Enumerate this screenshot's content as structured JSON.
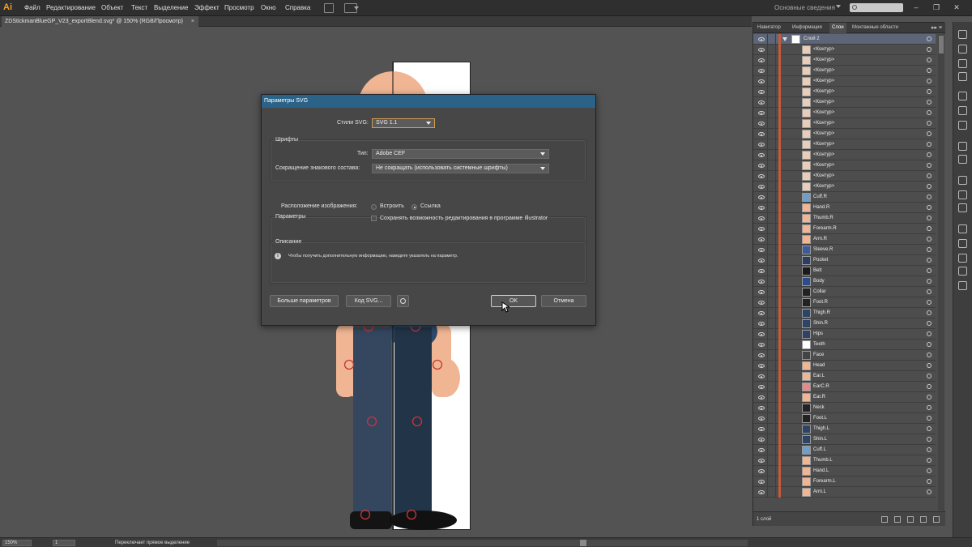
{
  "app": {
    "logo": "Ai",
    "menu": [
      "Файл",
      "Редактирование",
      "Объект",
      "Текст",
      "Выделение",
      "Эффект",
      "Просмотр",
      "Окно",
      "Справка"
    ],
    "workspace": "Основные сведения"
  },
  "document": {
    "tab_title": "ZDStickmanBlueGP_V23_exportBlend.svg* @ 150% (RGB/Просмотр)",
    "tab_close": "×"
  },
  "statusbar": {
    "zoom": "150%",
    "artboard": "1",
    "message": "Переключает прямое выделение"
  },
  "panel": {
    "tabs": [
      "Навигатор",
      "Информация",
      "Слои",
      "Монтажные области"
    ],
    "active_tab": "Слои",
    "layer_count": "1 слой",
    "layers": [
      {
        "name": "Слой 2",
        "thumb": "#ffffff",
        "sel": true,
        "top": true
      },
      {
        "name": "<Контур>",
        "thumb": "#e9cdb8"
      },
      {
        "name": "<Контур>",
        "thumb": "#e9cdb8"
      },
      {
        "name": "<Контур>",
        "thumb": "#e9cdb8"
      },
      {
        "name": "<Контур>",
        "thumb": "#e9cdb8"
      },
      {
        "name": "<Контур>",
        "thumb": "#e9cdb8"
      },
      {
        "name": "<Контур>",
        "thumb": "#e9cdb8"
      },
      {
        "name": "<Контур>",
        "thumb": "#e9cdb8"
      },
      {
        "name": "<Контур>",
        "thumb": "#e9cdb8"
      },
      {
        "name": "<Контур>",
        "thumb": "#e9cdb8"
      },
      {
        "name": "<Контур>",
        "thumb": "#e9cdb8"
      },
      {
        "name": "<Контур>",
        "thumb": "#e9cdb8"
      },
      {
        "name": "<Контур>",
        "thumb": "#e9cdb8"
      },
      {
        "name": "<Контур>",
        "thumb": "#e9cdb8"
      },
      {
        "name": "<Контур>",
        "thumb": "#e9cdb8"
      },
      {
        "name": "Cuff.R",
        "thumb": "#6f9ec9"
      },
      {
        "name": "Hand.R",
        "thumb": "#f0b694"
      },
      {
        "name": "Thumb.R",
        "thumb": "#f0b694"
      },
      {
        "name": "Forearm.R",
        "thumb": "#f0b694"
      },
      {
        "name": "Arm.R",
        "thumb": "#f0b694"
      },
      {
        "name": "Sleeve.R",
        "thumb": "#3a5b9c"
      },
      {
        "name": "Pocket",
        "thumb": "#2a3d64"
      },
      {
        "name": "Belt",
        "thumb": "#1a1a1a"
      },
      {
        "name": "Body",
        "thumb": "#2d4d8a"
      },
      {
        "name": "Collar",
        "thumb": "#222222"
      },
      {
        "name": "Foot.R",
        "thumb": "#222222"
      },
      {
        "name": "Thigh.R",
        "thumb": "#2e4466"
      },
      {
        "name": "Shin.R",
        "thumb": "#2e4466"
      },
      {
        "name": "Hips",
        "thumb": "#2e4466"
      },
      {
        "name": "Teeth",
        "thumb": "#ffffff"
      },
      {
        "name": "Face",
        "thumb": "#444444"
      },
      {
        "name": "Head",
        "thumb": "#f0b694"
      },
      {
        "name": "Ear.L",
        "thumb": "#f0b694"
      },
      {
        "name": "EarC.R",
        "thumb": "#e58a8a"
      },
      {
        "name": "Ear.R",
        "thumb": "#f0b694"
      },
      {
        "name": "Neck",
        "thumb": "#222222"
      },
      {
        "name": "Foot.L",
        "thumb": "#222222"
      },
      {
        "name": "Thigh.L",
        "thumb": "#2e4466"
      },
      {
        "name": "Shin.L",
        "thumb": "#2e4466"
      },
      {
        "name": "Cuff.L",
        "thumb": "#6f9ec9"
      },
      {
        "name": "Thumb.L",
        "thumb": "#f0b694"
      },
      {
        "name": "Hand.L",
        "thumb": "#f0b694"
      },
      {
        "name": "Forearm.L",
        "thumb": "#f0b694"
      },
      {
        "name": "Arm.L",
        "thumb": "#f0b694"
      }
    ]
  },
  "dialog": {
    "title": "Параметры SVG",
    "svg_profile_label": "Стили SVG:",
    "svg_profile_value": "SVG 1.1",
    "fonts_group": "Шрифты",
    "type_label": "Тип:",
    "type_value": "Adobe CEF",
    "subset_label": "Сокращение знакового состава:",
    "subset_value": "Не сокращать (использовать системные шрифты)",
    "options_group": "Параметры",
    "image_location_label": "Расположение изображения:",
    "embed_label": "Встроить",
    "link_label": "Ссылка",
    "preserve_label": "Сохранять возможность редактирования в программе Illustrator",
    "description_group": "Описание",
    "description_text": "Чтобы получить дополнительную информацию, наведите указатель на параметр.",
    "more_options": "Больше параметров",
    "svg_code": "Код SVG...",
    "ok": "OK",
    "cancel": "Отмена"
  },
  "colors": {
    "skin": "#f0b694",
    "pants_left": "#34475f",
    "pants_right": "#223447",
    "shoe": "#111111",
    "joint": "#c8343a",
    "title_bar": "#2b6388"
  }
}
